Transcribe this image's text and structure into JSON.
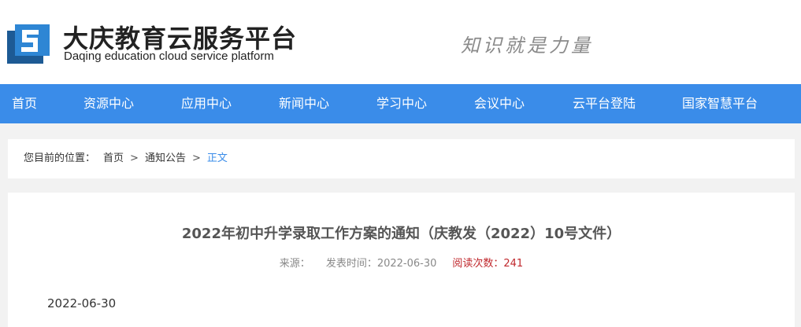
{
  "header": {
    "title": "大庆教育云服务平台",
    "subtitle": "Daqing education cloud service platform",
    "slogan": "知识就是力量",
    "logo_icon": "platform-logo-icon",
    "colors": {
      "logo_dark": "#1d5a94",
      "logo_light": "#2e86d4"
    }
  },
  "nav": {
    "items": [
      {
        "label": "首页"
      },
      {
        "label": "资源中心"
      },
      {
        "label": "应用中心"
      },
      {
        "label": "新闻中心"
      },
      {
        "label": "学习中心"
      },
      {
        "label": "会议中心"
      },
      {
        "label": "云平台登陆"
      },
      {
        "label": "国家智慧平台"
      }
    ],
    "color": "#3a8ce9"
  },
  "breadcrumb": {
    "prefix": "您目前的位置：",
    "items": [
      "首页",
      "通知公告",
      "正文"
    ],
    "separator": ">"
  },
  "article": {
    "title": "2022年初中升学录取工作方案的通知（庆教发（2022）10号文件）",
    "source_label": "来源：",
    "publish_label": "发表时间：2022-06-30",
    "read_count_label": "阅读次数：241",
    "date": "2022-06-30"
  }
}
